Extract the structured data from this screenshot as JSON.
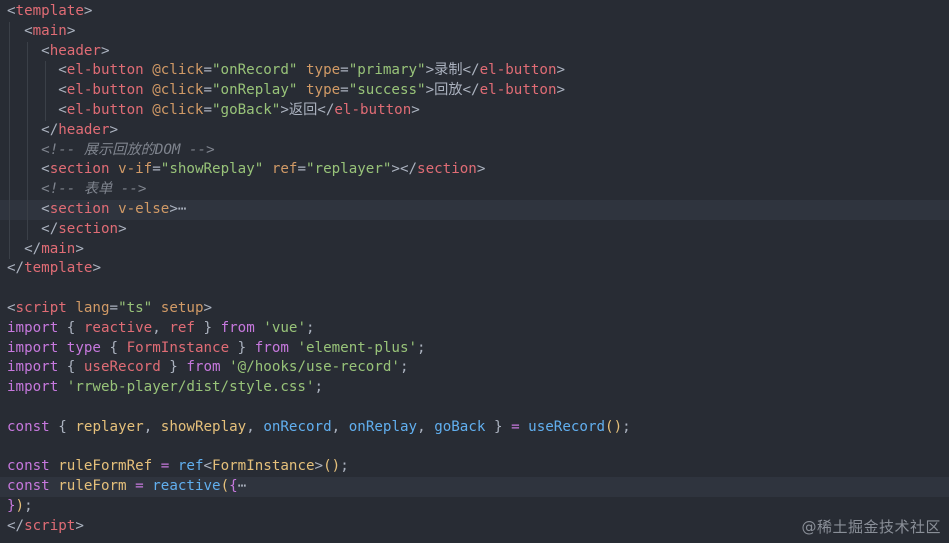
{
  "watermark": "@稀土掘金技术社区",
  "colors": {
    "background": "#282c34",
    "tag": "#e06c75",
    "attribute": "#d19a66",
    "string": "#98c379",
    "comment": "#7f848e",
    "keyword": "#c678dd",
    "function": "#61afef",
    "type": "#e5c07b"
  },
  "lines": [
    [
      [
        "punct",
        "<"
      ],
      [
        "tag",
        "template"
      ],
      [
        "punct",
        ">"
      ]
    ],
    [
      [
        "ws",
        "  "
      ],
      [
        "punct",
        "<"
      ],
      [
        "tag",
        "main"
      ],
      [
        "punct",
        ">"
      ]
    ],
    [
      [
        "ws",
        "    "
      ],
      [
        "punct",
        "<"
      ],
      [
        "tag",
        "header"
      ],
      [
        "punct",
        ">"
      ]
    ],
    [
      [
        "ws",
        "      "
      ],
      [
        "punct",
        "<"
      ],
      [
        "tag",
        "el-button"
      ],
      [
        "ws",
        " "
      ],
      [
        "attr",
        "@click"
      ],
      [
        "punct",
        "="
      ],
      [
        "str",
        "\"onRecord\""
      ],
      [
        "ws",
        " "
      ],
      [
        "attr",
        "type"
      ],
      [
        "punct",
        "="
      ],
      [
        "str",
        "\"primary\""
      ],
      [
        "punct",
        ">"
      ],
      [
        "text",
        "录制"
      ],
      [
        "punct",
        "</"
      ],
      [
        "tag",
        "el-button"
      ],
      [
        "punct",
        ">"
      ]
    ],
    [
      [
        "ws",
        "      "
      ],
      [
        "punct",
        "<"
      ],
      [
        "tag",
        "el-button"
      ],
      [
        "ws",
        " "
      ],
      [
        "attr",
        "@click"
      ],
      [
        "punct",
        "="
      ],
      [
        "str",
        "\"onReplay\""
      ],
      [
        "ws",
        " "
      ],
      [
        "attr",
        "type"
      ],
      [
        "punct",
        "="
      ],
      [
        "str",
        "\"success\""
      ],
      [
        "punct",
        ">"
      ],
      [
        "text",
        "回放"
      ],
      [
        "punct",
        "</"
      ],
      [
        "tag",
        "el-button"
      ],
      [
        "punct",
        ">"
      ]
    ],
    [
      [
        "ws",
        "      "
      ],
      [
        "punct",
        "<"
      ],
      [
        "tag",
        "el-button"
      ],
      [
        "ws",
        " "
      ],
      [
        "attr",
        "@click"
      ],
      [
        "punct",
        "="
      ],
      [
        "str",
        "\"goBack\""
      ],
      [
        "punct",
        ">"
      ],
      [
        "text",
        "返回"
      ],
      [
        "punct",
        "</"
      ],
      [
        "tag",
        "el-button"
      ],
      [
        "punct",
        ">"
      ]
    ],
    [
      [
        "ws",
        "    "
      ],
      [
        "punct",
        "</"
      ],
      [
        "tag",
        "header"
      ],
      [
        "punct",
        ">"
      ]
    ],
    [
      [
        "ws",
        "    "
      ],
      [
        "comment",
        "<!-- 展示回放的DOM -->"
      ]
    ],
    [
      [
        "ws",
        "    "
      ],
      [
        "punct",
        "<"
      ],
      [
        "tag",
        "section"
      ],
      [
        "ws",
        " "
      ],
      [
        "attr",
        "v-if"
      ],
      [
        "punct",
        "="
      ],
      [
        "str",
        "\"showReplay\""
      ],
      [
        "ws",
        " "
      ],
      [
        "attr",
        "ref"
      ],
      [
        "punct",
        "="
      ],
      [
        "str",
        "\"replayer\""
      ],
      [
        "punct",
        "></"
      ],
      [
        "tag",
        "section"
      ],
      [
        "punct",
        ">"
      ]
    ],
    [
      [
        "ws",
        "    "
      ],
      [
        "comment",
        "<!-- 表单 -->"
      ]
    ],
    [
      [
        "ws",
        "    "
      ],
      [
        "punct",
        "<"
      ],
      [
        "tag",
        "section"
      ],
      [
        "ws",
        " "
      ],
      [
        "attr",
        "v-else"
      ],
      [
        "punct",
        ">"
      ],
      [
        "ellipsis",
        "⋯"
      ]
    ],
    [
      [
        "ws",
        "    "
      ],
      [
        "punct",
        "</"
      ],
      [
        "tag",
        "section"
      ],
      [
        "punct",
        ">"
      ]
    ],
    [
      [
        "ws",
        "  "
      ],
      [
        "punct",
        "</"
      ],
      [
        "tag",
        "main"
      ],
      [
        "punct",
        ">"
      ]
    ],
    [
      [
        "punct",
        "</"
      ],
      [
        "tag",
        "template"
      ],
      [
        "punct",
        ">"
      ]
    ],
    [],
    [
      [
        "punct",
        "<"
      ],
      [
        "tag",
        "script"
      ],
      [
        "ws",
        " "
      ],
      [
        "attr",
        "lang"
      ],
      [
        "punct",
        "="
      ],
      [
        "str",
        "\"ts\""
      ],
      [
        "ws",
        " "
      ],
      [
        "attr",
        "setup"
      ],
      [
        "punct",
        ">"
      ]
    ],
    [
      [
        "kw",
        "import"
      ],
      [
        "ws",
        " "
      ],
      [
        "punct",
        "{ "
      ],
      [
        "var",
        "reactive"
      ],
      [
        "punct",
        ", "
      ],
      [
        "var",
        "ref"
      ],
      [
        "punct",
        " } "
      ],
      [
        "kw",
        "from"
      ],
      [
        "ws",
        " "
      ],
      [
        "str",
        "'vue'"
      ],
      [
        "punct",
        ";"
      ]
    ],
    [
      [
        "kw",
        "import"
      ],
      [
        "ws",
        " "
      ],
      [
        "kw",
        "type"
      ],
      [
        "ws",
        " "
      ],
      [
        "punct",
        "{ "
      ],
      [
        "var",
        "FormInstance"
      ],
      [
        "punct",
        " } "
      ],
      [
        "kw",
        "from"
      ],
      [
        "ws",
        " "
      ],
      [
        "str",
        "'element-plus'"
      ],
      [
        "punct",
        ";"
      ]
    ],
    [
      [
        "kw",
        "import"
      ],
      [
        "ws",
        " "
      ],
      [
        "punct",
        "{ "
      ],
      [
        "var",
        "useRecord"
      ],
      [
        "punct",
        " } "
      ],
      [
        "kw",
        "from"
      ],
      [
        "ws",
        " "
      ],
      [
        "str",
        "'@/hooks/use-record'"
      ],
      [
        "punct",
        ";"
      ]
    ],
    [
      [
        "kw",
        "import"
      ],
      [
        "ws",
        " "
      ],
      [
        "str",
        "'rrweb-player/dist/style.css'"
      ],
      [
        "punct",
        ";"
      ]
    ],
    [],
    [
      [
        "kw",
        "const"
      ],
      [
        "ws",
        " "
      ],
      [
        "punct",
        "{ "
      ],
      [
        "type",
        "replayer"
      ],
      [
        "punct",
        ", "
      ],
      [
        "type",
        "showReplay"
      ],
      [
        "punct",
        ", "
      ],
      [
        "fn",
        "onRecord"
      ],
      [
        "punct",
        ", "
      ],
      [
        "fn",
        "onReplay"
      ],
      [
        "punct",
        ", "
      ],
      [
        "fn",
        "goBack"
      ],
      [
        "punct",
        " } "
      ],
      [
        "kw",
        "="
      ],
      [
        "ws",
        " "
      ],
      [
        "fn",
        "useRecord"
      ],
      [
        "type",
        "()"
      ],
      [
        "punct",
        ";"
      ]
    ],
    [],
    [
      [
        "kw",
        "const"
      ],
      [
        "ws",
        " "
      ],
      [
        "type",
        "ruleFormRef"
      ],
      [
        "ws",
        " "
      ],
      [
        "kw",
        "="
      ],
      [
        "ws",
        " "
      ],
      [
        "fn",
        "ref"
      ],
      [
        "punct",
        "<"
      ],
      [
        "type",
        "FormInstance"
      ],
      [
        "punct",
        ">"
      ],
      [
        "type",
        "()"
      ],
      [
        "punct",
        ";"
      ]
    ],
    [
      [
        "kw",
        "const"
      ],
      [
        "ws",
        " "
      ],
      [
        "type",
        "ruleForm"
      ],
      [
        "ws",
        " "
      ],
      [
        "kw",
        "="
      ],
      [
        "ws",
        " "
      ],
      [
        "fn",
        "reactive"
      ],
      [
        "type",
        "("
      ],
      [
        "kw",
        "{"
      ],
      [
        "ellipsis",
        "⋯"
      ]
    ],
    [
      [
        "kw",
        "}"
      ],
      [
        "type",
        ")"
      ],
      [
        "punct",
        ";"
      ]
    ],
    [
      [
        "punct",
        "</"
      ],
      [
        "tag",
        "script"
      ],
      [
        "punct",
        ">"
      ]
    ]
  ]
}
